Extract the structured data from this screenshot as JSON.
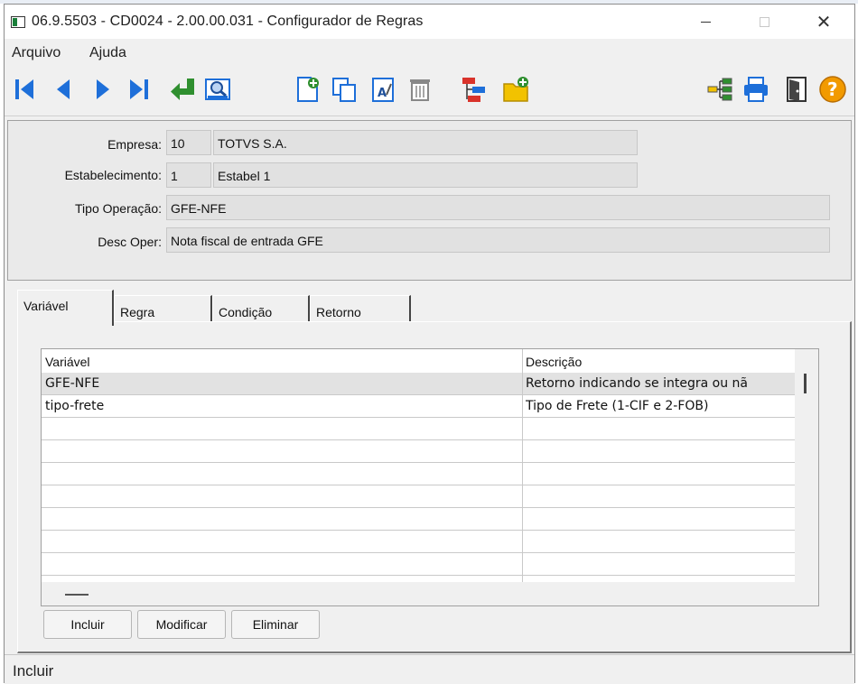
{
  "window": {
    "title": "06.9.5503 - CD0024 - 2.00.00.031 - Configurador de Regras",
    "minimize_glyph": "",
    "maximize_glyph": "",
    "close_glyph": "✕"
  },
  "menu": {
    "items": [
      "Arquivo",
      "Ajuda"
    ]
  },
  "toolbar": {
    "icons": [
      "first-record-icon",
      "previous-record-icon",
      "next-record-icon",
      "last-record-icon",
      "goto-icon",
      "search-icon",
      "new-icon",
      "copy-icon",
      "edit-icon",
      "delete-icon",
      "hierarchy-icon",
      "new-folder-icon",
      "tree-icon",
      "print-icon",
      "exit-icon",
      "help-icon"
    ],
    "help_glyph": "?",
    "edit_glyph": "A"
  },
  "header": {
    "empresa": {
      "label": "Empresa:",
      "code": "10",
      "name": "TOTVS S.A."
    },
    "estabelecimento": {
      "label": "Estabelecimento:",
      "code": "1",
      "name": "Estabel 1"
    },
    "tipo_operacao": {
      "label": "Tipo Operação:",
      "value": "GFE-NFE"
    },
    "desc_oper": {
      "label": "Desc Oper:",
      "value": "Nota fiscal de entrada GFE"
    }
  },
  "tabs": [
    {
      "label": "Variável",
      "active": true
    },
    {
      "label": "Regra",
      "active": false
    },
    {
      "label": "Condição",
      "active": false
    },
    {
      "label": "Retorno",
      "active": false
    }
  ],
  "grid": {
    "columns": [
      "Variável",
      "Descrição"
    ],
    "rows": [
      {
        "variavel": "GFE-NFE",
        "descricao": "Retorno indicando se integra ou nã"
      },
      {
        "variavel": "tipo-frete",
        "descricao": "Tipo de Frete (1-CIF e 2-FOB)"
      }
    ],
    "empty_rows": 7
  },
  "actions": {
    "incluir": "Incluir",
    "modificar": "Modificar",
    "eliminar": "Eliminar"
  },
  "status": {
    "text": "Incluir"
  },
  "colors": {
    "toolbar_blue": "#1e6fd9",
    "accent_green": "#2f8f2f",
    "accent_yellow": "#f2c200",
    "help_orange": "#f29a00"
  }
}
